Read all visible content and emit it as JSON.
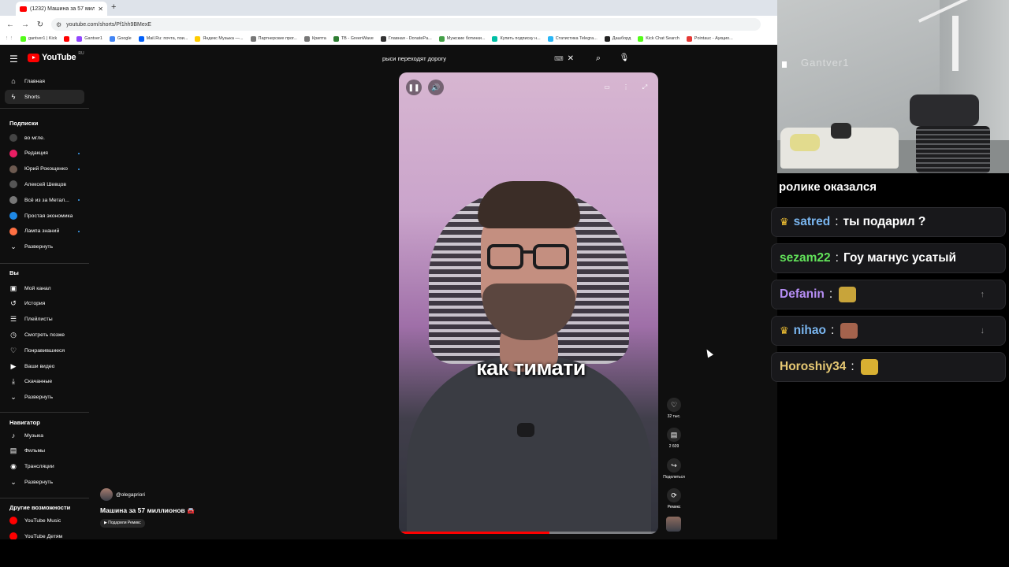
{
  "browser": {
    "tab_title": "(1232) Машина за 57 милл...",
    "url": "youtube.com/shorts/Pf1hh9BMexE",
    "bookmarks": [
      {
        "label": "gantver1 | Kick",
        "color": "#53fc18"
      },
      {
        "label": "",
        "color": "#ff0000"
      },
      {
        "label": "Gantver1",
        "color": "#9146ff"
      },
      {
        "label": "Google",
        "color": "#4285f4"
      },
      {
        "label": "Mail.Ru: почта, пои...",
        "color": "#005ff9"
      },
      {
        "label": "Яндекс Музыка —...",
        "color": "#ffcc00"
      },
      {
        "label": "Партнерские прог...",
        "color": "#777777"
      },
      {
        "label": "Крипта",
        "color": "#777777"
      },
      {
        "label": "TB - GreenWave",
        "color": "#2e7d32"
      },
      {
        "label": "Главная - DonatePa...",
        "color": "#333333"
      },
      {
        "label": "Мужские ботинки...",
        "color": "#43a047"
      },
      {
        "label": "Купить подписку н...",
        "color": "#00bfa5"
      },
      {
        "label": "Статистика Telegra...",
        "color": "#29b6f6"
      },
      {
        "label": "Дашборд",
        "color": "#222222"
      },
      {
        "label": "Kick Chat Search",
        "color": "#53fc18"
      },
      {
        "label": "Pointauc - Аукцио...",
        "color": "#e53935"
      }
    ]
  },
  "header": {
    "logo": "YouTube",
    "logo_region": "RU",
    "search_query": "рыси переходят дорогу"
  },
  "sidebar": {
    "main": [
      {
        "label": "Главная",
        "icon": "⌂"
      },
      {
        "label": "Shorts",
        "icon": "ϟ"
      }
    ],
    "subs_heading": "Подписки",
    "subs": [
      {
        "label": "во мгле.",
        "color": "#444444",
        "live": false
      },
      {
        "label": "Редакция",
        "color": "#e91e63",
        "live": true
      },
      {
        "label": "Юрий Рокощенко",
        "color": "#6d5a50",
        "live": true
      },
      {
        "label": "Алексей Шевцов",
        "color": "#555555",
        "live": false
      },
      {
        "label": "Всё из за Метал...",
        "color": "#777777",
        "live": true
      },
      {
        "label": "Простая экономика",
        "color": "#1e88e5",
        "live": false
      },
      {
        "label": "Лампа знаний",
        "color": "#ff7043",
        "live": true
      },
      {
        "label": "Развернуть",
        "icon": "⌄"
      }
    ],
    "you_heading": "Вы",
    "you": [
      {
        "label": "Мой канал",
        "icon": "▣"
      },
      {
        "label": "История",
        "icon": "↺"
      },
      {
        "label": "Плейлисты",
        "icon": "☰"
      },
      {
        "label": "Смотреть позже",
        "icon": "◷"
      },
      {
        "label": "Понравившиеся",
        "icon": "♡"
      },
      {
        "label": "Ваши видео",
        "icon": "▶"
      },
      {
        "label": "Скачанные",
        "icon": "⤓"
      },
      {
        "label": "Развернуть",
        "icon": "⌄"
      }
    ],
    "nav_heading": "Навигатор",
    "nav": [
      {
        "label": "Музыка",
        "icon": "♪"
      },
      {
        "label": "Фильмы",
        "icon": "▤"
      },
      {
        "label": "Трансляции",
        "icon": "◉"
      },
      {
        "label": "Развернуть",
        "icon": "⌄"
      }
    ],
    "more_heading": "Другие возможности",
    "more": [
      {
        "label": "YouTube Music",
        "color": "#ff0000"
      },
      {
        "label": "YouTube Детям",
        "color": "#ff0000"
      }
    ]
  },
  "video": {
    "caption": "как тимати",
    "progress": 0.58
  },
  "actions": {
    "likes": "32 тыс.",
    "comments": "2 609",
    "share": "Поделиться",
    "remix": "Ремикс"
  },
  "short_info": {
    "handle": "@olegapriori",
    "title": "Машина за 57 миллионов",
    "remix_chip": "▶ Подарили Ремикс"
  },
  "webcam": {
    "watermark": "Gantver1"
  },
  "chat": {
    "cut_line": "ролике оказался",
    "messages": [
      {
        "user": "satred",
        "text": "ты подарил ?",
        "color": "#7ab6f0",
        "badge": true,
        "emote": ""
      },
      {
        "user": "sezam22",
        "text": "Гоу магнус усатый",
        "color": "#62e35a",
        "badge": false,
        "emote": ""
      },
      {
        "user": "Defanin",
        "text": "",
        "color": "#b68ef5",
        "badge": false,
        "emote": "#c8a43a"
      },
      {
        "user": "nihao",
        "text": "",
        "color": "#7ab6f0",
        "badge": true,
        "emote": "#a4634d"
      },
      {
        "user": "Horoshiy34",
        "text": "",
        "color": "#e6c873",
        "badge": false,
        "emote": "#d8b032"
      }
    ]
  }
}
